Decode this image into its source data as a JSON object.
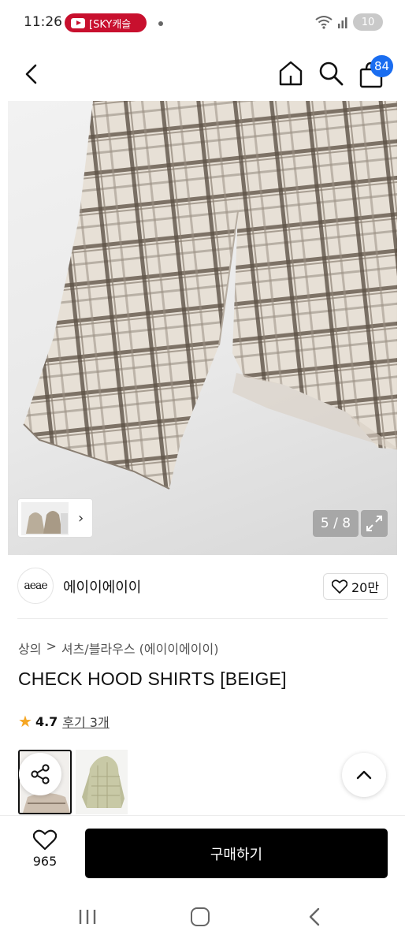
{
  "status_bar": {
    "time": "11:26",
    "notification": "[SKY캐슬",
    "battery": "10",
    "icons": [
      "youtube-icon",
      "wifi-icon",
      "signal-icon",
      "battery-icon"
    ]
  },
  "header": {
    "icons": [
      "back-arrow-icon",
      "home-icon",
      "search-icon",
      "cart-icon"
    ],
    "cart_count": "84"
  },
  "gallery": {
    "counter": "5 / 8",
    "expand_icon": "expand-icon"
  },
  "brand": {
    "logo_text": "aeae",
    "name": "에이이에이이",
    "like_count": "20만"
  },
  "breadcrumb": {
    "category": "상의",
    "separator": ">",
    "subcategory": "셔츠/블라우스 (에이이에이이)"
  },
  "product": {
    "title": "CHECK HOOD SHIRTS [BEIGE]",
    "rating": "4.7",
    "reviews": "후기 3개"
  },
  "colors": {
    "accent": "#000000",
    "badge": "#1a6df0",
    "star": "#f5a623",
    "notification": "#c8102e"
  },
  "bottom_bar": {
    "wish_count": "965",
    "buy_label": "구매하기"
  }
}
